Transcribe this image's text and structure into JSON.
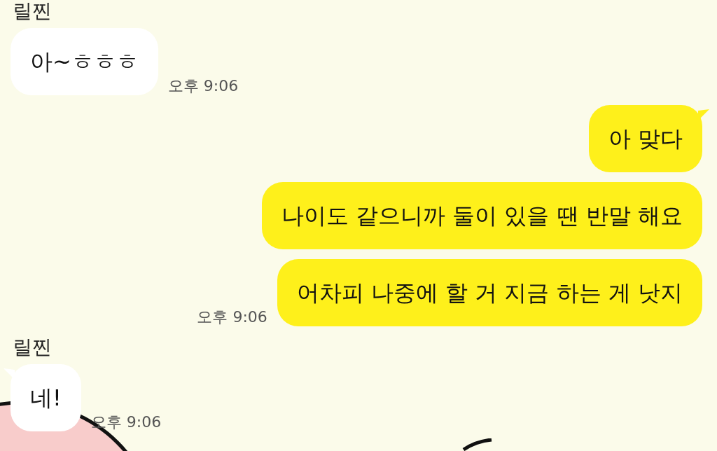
{
  "messages": [
    {
      "kind": "sender_name",
      "text": "릴찐"
    },
    {
      "kind": "incoming",
      "tail": false,
      "text": "아~ㅎㅎㅎ",
      "time": "오후 9:06"
    },
    {
      "kind": "outgoing",
      "tail": true,
      "text": "아 맞다"
    },
    {
      "kind": "outgoing",
      "tail": false,
      "text": "나이도 같으니까 둘이 있을 땐 반말 해요"
    },
    {
      "kind": "outgoing",
      "tail": false,
      "text": "어차피 나중에 할 거 지금 하는 게 낫지",
      "time": "오후 9:06"
    },
    {
      "kind": "sender_name",
      "text": "릴찐"
    },
    {
      "kind": "incoming",
      "tail": true,
      "text": "네!",
      "time": "오후 9:06"
    }
  ]
}
